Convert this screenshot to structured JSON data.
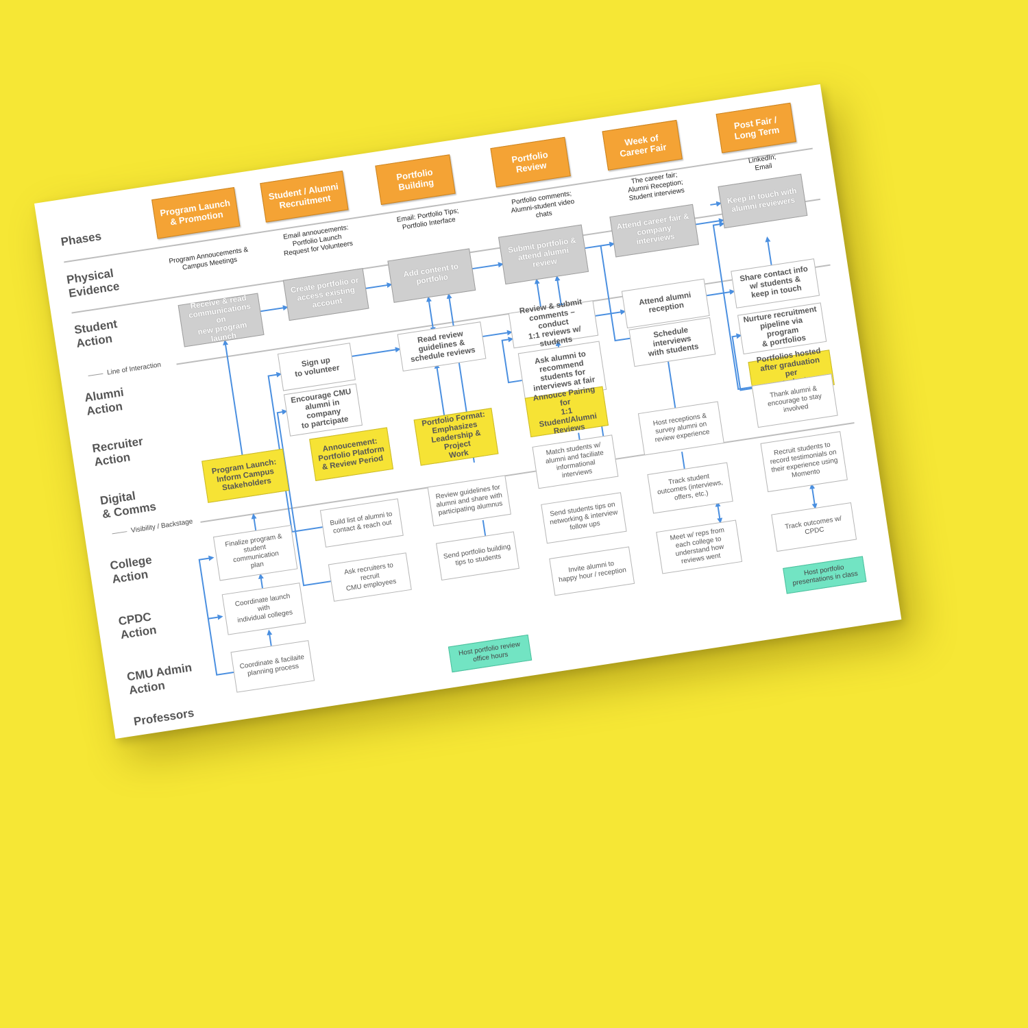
{
  "lanes": {
    "phases": "Phases",
    "physical_evidence": "Physical\nEvidence",
    "student_action": "Student\nAction",
    "alumni_action": "Alumni\nAction",
    "recruiter_action": "Recruiter\nAction",
    "digital_comms": "Digital\n& Comms",
    "college_action": "College\nAction",
    "cpdc_action": "CPDC\nAction",
    "cmu_admin_action": "CMU Admin\nAction",
    "professors": "Professors"
  },
  "dividers": {
    "line_of_interaction": "Line of Interaction",
    "visibility_backstage": "Visibility / Backstage"
  },
  "phases": [
    "Program Launch\n& Promotion",
    "Student / Alumni\nRecruitment",
    "Portfolio\nBuilding",
    "Portfolio\nReview",
    "Week of\nCareer Fair",
    "Post Fair /\nLong Term"
  ],
  "physical_evidence": [
    "Program Annoucements &\nCampus Meetings",
    "Email annoucements:\nPortfolio Launch\nRequest for Volunteers",
    "Email: Portfolio Tips;\nPortfolio Interface",
    "Portfolio comments;\nAlumni-student video\nchats",
    "The career fair;\nAlumni Reception;\nStudent interviews",
    "LinkedIn;\nEmail"
  ],
  "student_actions": {
    "receive": "Receive & read\ncommunications on\nnew program launch",
    "create_portfolio": "Create portfolio or\naccess existing\naccount",
    "add_content": "Add content to\nportfolio",
    "submit_portfolio": "Submit portfolio &\nattend alumni\nreview",
    "attend_fair": "Attend career fair &\ncompany interviews",
    "keep_in_touch": "Keep in touch with\nalumni reviewers"
  },
  "alumni_actions": {
    "sign_up": "Sign up\nto volunteer",
    "read_guidelines": "Read review\nguidelines &\nschedule reviews",
    "review_submit": "Review & submit\ncomments – conduct\n1:1 reviews w/\nstudents",
    "attend_reception": "Attend alumni\nreception",
    "share_contact": "Share contact info\nw/ students &\nkeep in touch"
  },
  "recruiter_actions": {
    "encourage": "Encourage CMU\nalumni in company\nto partcipate",
    "ask_alumni": "Ask alumni to\nrecommend\nstudents for\ninterviews at fair",
    "schedule_interviews": "Schedule interviews\nwith students",
    "nurture": "Nurture recruitment\npipeline via program\n& portfolios"
  },
  "digital_comms": {
    "program_launch": "Program Launch:\nInform Campus\nStakeholders",
    "annoucement": "Annoucement:\nPortfolio Platform\n& Review Period",
    "portfolio_format": "Portfolio Format:\nEmphasizes\nLeadership & Project\nWork",
    "annouce_pairing": "Annouce Pairing for\n1:1 Student/Alumni\nReviews",
    "portfolios_hosted": "Portfolios hosted\nafter graduation per\nstudent preferences"
  },
  "backstage": {
    "finalize_program": "Finalize program &\nstudent communication\nplan",
    "coordinate_launch": "Coordinate launch with\nindividual colleges",
    "coordinate_facilitate": "Coordinate & facilaite\nplanning process",
    "build_list": "Build list of alumni to\ncontact & reach out",
    "ask_recruiters": "Ask recruiters to recruit\nCMU employees",
    "review_guidelines": "Review guidelines for\nalumni and share with\nparticipating alumnus",
    "send_tips": "Send portfolio building\ntips to students",
    "match_students": "Match students w/\nalumni and faciliate\ninformational\ninterviews",
    "send_networking": "Send students tips on\nnetworking & interview\nfollow ups",
    "invite_alumni": "Invite alumni to\nhappy hour / reception",
    "host_receptions": "Host receptions &\nsurvey alumni on\nreview experience",
    "track_outcomes": "Track student\noutcomes (interviews,\noffers, etc.)",
    "meet_reps": "Meet w/ reps from\neach college to\nunderstand how\nreviews went",
    "thank_alumni": "Thank alumni &\nencourage to stay\ninvolved",
    "recruit_students": "Recruit students to\nrecord testimonials on\ntheir experience using\nMomento",
    "track_cpdc": "Track outcomes w/\nCPDC"
  },
  "professors": {
    "office_hours": "Host portfolio review\noffice hours",
    "presentations": "Host portfolio\npresentations in class"
  },
  "colors": {
    "background": "#f6e735",
    "phase": "#f4a335",
    "student": "#cfcfcf",
    "digital": "#f6e335",
    "professor": "#72e4c3",
    "arrow": "#4a8fe0"
  }
}
